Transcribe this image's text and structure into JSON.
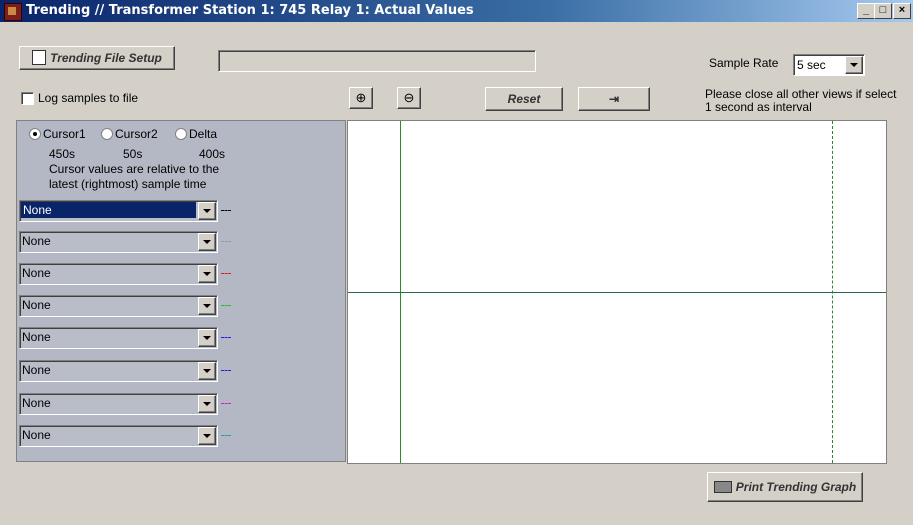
{
  "window": {
    "title": "Trending // Transformer Station 1: 745 Relay 1: Actual Values",
    "min_label": "_",
    "max_label": "□",
    "close_label": "×"
  },
  "toolbar": {
    "file_setup_label": "Trending File Setup",
    "file_path_value": "",
    "log_samples_label": "Log samples to file",
    "log_samples_checked": false,
    "reset_label": "Reset",
    "sample_rate_label": "Sample Rate",
    "sample_rate_value": "5 sec",
    "note": "Please close all other views if select 1 second as interval"
  },
  "cursors": {
    "options": [
      "Cursor1",
      "Cursor2",
      "Delta"
    ],
    "selected": "Cursor1",
    "values": [
      "450s",
      "50s",
      "400s"
    ],
    "note_line1": "Cursor values are relative to the",
    "note_line2": "latest (rightmost) sample time"
  },
  "channels": [
    {
      "value": "None",
      "color": "#000000"
    },
    {
      "value": "None",
      "color": "#9a9a9a"
    },
    {
      "value": "None",
      "color": "#e02020"
    },
    {
      "value": "None",
      "color": "#20c020"
    },
    {
      "value": "None",
      "color": "#2020e0"
    },
    {
      "value": "None",
      "color": "#2020e0"
    },
    {
      "value": "None",
      "color": "#d020d0"
    },
    {
      "value": "None",
      "color": "#20a0a0"
    }
  ],
  "graph": {
    "cursor1_color": "#2a8a2a",
    "cursor2_color": "#2a8a2a"
  },
  "footer": {
    "print_label": "Print Trending Graph"
  }
}
